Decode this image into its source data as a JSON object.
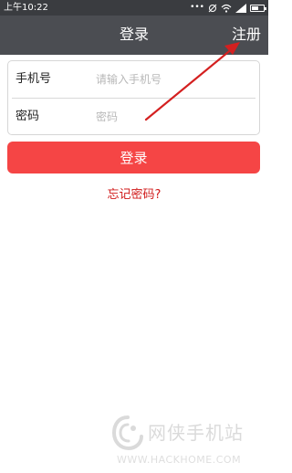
{
  "status_bar": {
    "time": "上午10:22",
    "icons": [
      "dots-icon",
      "alarm-off-icon",
      "wifi-icon",
      "signal-icon",
      "battery-icon"
    ]
  },
  "nav": {
    "title": "登录",
    "register_label": "注册",
    "background": "#4b4d52"
  },
  "form": {
    "phone": {
      "label": "手机号",
      "placeholder": "请输入手机号",
      "value": ""
    },
    "password": {
      "label": "密码",
      "placeholder": "密码",
      "value": ""
    }
  },
  "actions": {
    "login_label": "登录",
    "login_color": "#f54545",
    "forgot_label": "忘记密码?",
    "forgot_color": "#d01818"
  },
  "annotation": {
    "color": "#d42020"
  },
  "watermark": {
    "name": "网侠手机站",
    "url": "WWW.HACKHOME.COM"
  }
}
